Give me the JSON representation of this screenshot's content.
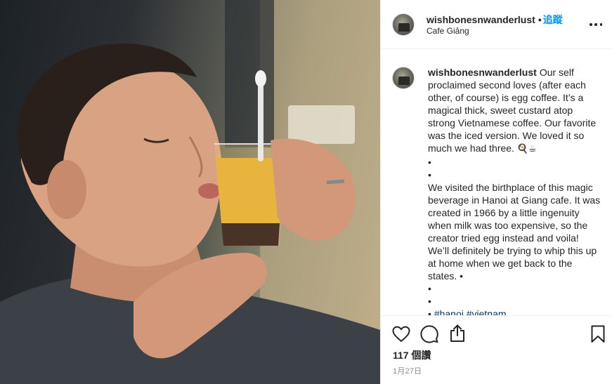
{
  "post": {
    "author": "wishbonesnwanderlust",
    "separator": "•",
    "follow_label": "追蹤",
    "location": "Cafe Giảng"
  },
  "caption": {
    "username": "wishbonesnwanderlust",
    "paragraph1": "Our self proclaimed second loves (after each other, of course) is egg coffee. It’s a magical thick, sweet custard atop strong Vietnamese coffee. Our favorite was the iced version. We loved it so much we had three.",
    "emoji": "🍳☕",
    "bullet1": "•",
    "bullet2": "•",
    "paragraph2": "We visited the birthplace of this magic beverage in Hanoi at Giang cafe. It was created in 1966 by a little ingenuity when milk was too expensive, so the creator tried egg instead and voila! We’ll definitely be trying to whip this up at home when we get back to the states. •",
    "bullet3": "•",
    "bullet4": "•",
    "bullet5": "•",
    "hashtag1": "#hanoi",
    "hashtag2": "#vietnam"
  },
  "stats": {
    "likes": "117 個讚",
    "date": "1月27日"
  },
  "icons": {
    "like": "heart-icon",
    "comment": "comment-icon",
    "share": "share-icon",
    "save": "bookmark-icon",
    "more": "more-icon"
  },
  "colors": {
    "follow": "#0095f6",
    "hashtag": "#00376b",
    "date": "#8e8e8e",
    "text": "#262626",
    "divider": "#efefef"
  }
}
